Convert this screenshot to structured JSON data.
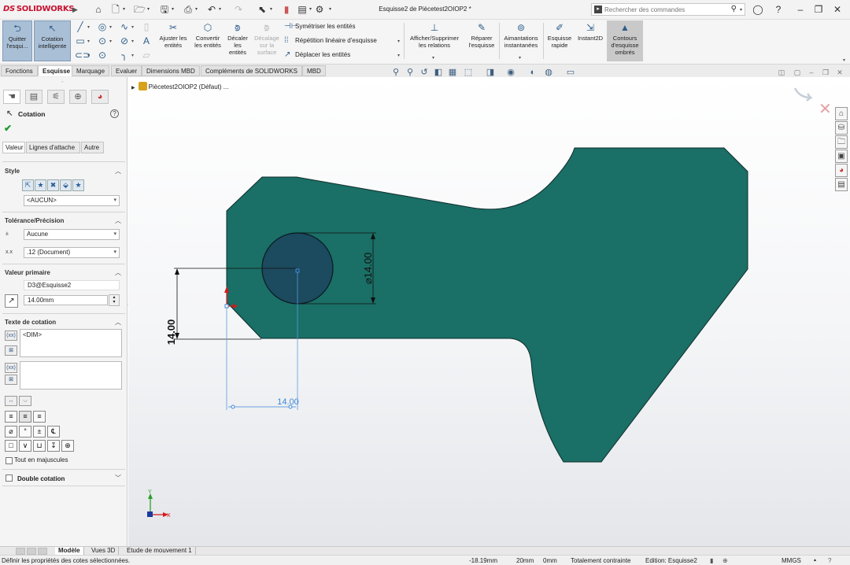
{
  "app": {
    "logo_ds": "DS",
    "logo_name": "SOLIDWORKS",
    "doc_title": "Esquisse2 de Piècetest2OIOP2 *"
  },
  "search": {
    "placeholder": "Rechercher des commandes"
  },
  "command_manager": {
    "quit_sketch": "Quitter l'esqui...",
    "smart_dimension": "Cotation intelligente",
    "trim": "Ajuster les entités",
    "convert": "Convertir les entités",
    "offset": "Décaler les entités",
    "offset_surface": "Décalage sur la surface",
    "mirror": "Symétriser les entités",
    "linear_pattern": "Répétition linéaire d'esquisse",
    "move": "Déplacer les entités",
    "relations": "Afficher/Supprimer les relations",
    "repair": "Réparer l'esquisse",
    "snaps": "Aimantations instantanées",
    "rapid_sketch": "Esquisse rapide",
    "instant2d": "Instant2D",
    "shaded_contours": "Contours d'esquisse ombrés"
  },
  "tabs": [
    "Fonctions",
    "Esquisse",
    "Marquage",
    "Evaluer",
    "Dimensions MBD",
    "Compléments de SOLIDWORKS",
    "MBD"
  ],
  "active_tab": "Esquisse",
  "property_manager": {
    "title": "Cotation",
    "subtabs": [
      "Valeur",
      "Lignes d'attache",
      "Autre"
    ],
    "style": {
      "header": "Style",
      "value": "<AUCUN>"
    },
    "tolerance": {
      "header": "Tolérance/Précision",
      "tolerance_value": "Aucune",
      "precision_value": ".12 (Document)"
    },
    "primary": {
      "header": "Valeur primaire",
      "name": "D3@Esquisse2",
      "value": "14.00mm"
    },
    "dim_text": {
      "header": "Texte de cotation",
      "text1": "<DIM>",
      "text2": ""
    },
    "uppercase_label": "Tout en majuscules",
    "dual_label": "Double cotation"
  },
  "feature_tree": {
    "root": "Piècetest2OIOP2 (Défaut) ..."
  },
  "sketch": {
    "dimensions": {
      "diameter": "⌀14.00",
      "vertical": "14.00",
      "horizontal": "14.00"
    },
    "axis_x": "X",
    "axis_y": "Y",
    "colors": {
      "shaded_region": "#1a6f66",
      "circle_fill": "#1c4a5e",
      "selected_dimension": "#3d87d6"
    }
  },
  "model_tabs": [
    "Modèle",
    "Vues 3D",
    "Etude de mouvement 1"
  ],
  "active_model_tab": "Modèle",
  "status": {
    "message": "Définir les propriétés des cotes sélectionnées.",
    "x": "-18.19mm",
    "y": "20mm",
    "z": "0mm",
    "state": "Totalement contrainte",
    "editing": "Edition: Esquisse2",
    "units": "MMGS"
  }
}
